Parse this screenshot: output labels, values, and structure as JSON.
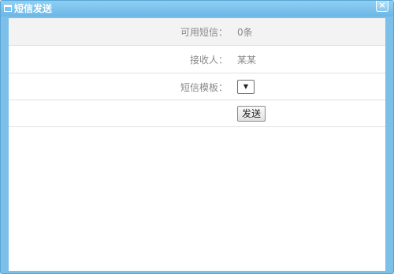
{
  "dialog": {
    "title": "短信发送",
    "close_symbol": "×"
  },
  "form": {
    "available_label": "可用短信：",
    "available_value": "0条",
    "recipient_label": "接收人：",
    "recipient_value": "某某",
    "template_label": "短信模板：",
    "template_arrow": "▼",
    "send_label": "发送"
  },
  "icons": {
    "title": "window-icon",
    "close": "close-icon",
    "dropdown": "chevron-down-icon"
  },
  "colors": {
    "titlebar": "#7cc0ea",
    "title_text": "#ffffff",
    "label_text": "#888888"
  }
}
